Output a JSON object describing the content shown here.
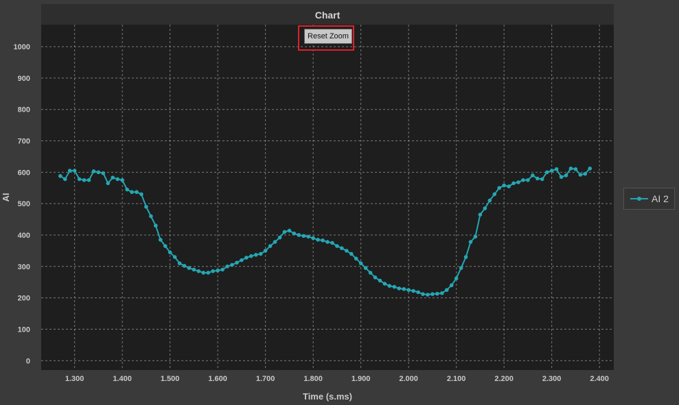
{
  "chart_data": {
    "type": "line",
    "title": "Chart",
    "xlabel": "Time (s.ms)",
    "ylabel": "AI",
    "xlim": [
      1.23,
      2.43
    ],
    "ylim": [
      -30,
      1070
    ],
    "x_ticks": [
      1.3,
      1.4,
      1.5,
      1.6,
      1.7,
      1.8,
      1.9,
      2.0,
      2.1,
      2.2,
      2.3,
      2.4
    ],
    "x_tick_labels": [
      "1.300",
      "1.400",
      "1.500",
      "1.600",
      "1.700",
      "1.800",
      "1.900",
      "2.000",
      "2.100",
      "2.200",
      "2.300",
      "2.400"
    ],
    "y_ticks": [
      0,
      100,
      200,
      300,
      400,
      500,
      600,
      700,
      800,
      900,
      1000
    ],
    "y_tick_labels": [
      "0",
      "100",
      "200",
      "300",
      "400",
      "500",
      "600",
      "700",
      "800",
      "900",
      "1000"
    ],
    "grid": true,
    "legend_position": "right",
    "series": [
      {
        "name": "AI 2",
        "color": "#25a7b3",
        "x": [
          1.27,
          1.28,
          1.29,
          1.3,
          1.31,
          1.32,
          1.33,
          1.34,
          1.35,
          1.36,
          1.37,
          1.38,
          1.39,
          1.4,
          1.41,
          1.42,
          1.43,
          1.44,
          1.45,
          1.46,
          1.47,
          1.48,
          1.49,
          1.5,
          1.51,
          1.52,
          1.53,
          1.54,
          1.55,
          1.56,
          1.57,
          1.58,
          1.59,
          1.6,
          1.61,
          1.62,
          1.63,
          1.64,
          1.65,
          1.66,
          1.67,
          1.68,
          1.69,
          1.7,
          1.71,
          1.72,
          1.73,
          1.74,
          1.75,
          1.76,
          1.77,
          1.78,
          1.79,
          1.8,
          1.81,
          1.82,
          1.83,
          1.84,
          1.85,
          1.86,
          1.87,
          1.88,
          1.89,
          1.9,
          1.91,
          1.92,
          1.93,
          1.94,
          1.95,
          1.96,
          1.97,
          1.98,
          1.99,
          2.0,
          2.01,
          2.02,
          2.03,
          2.04,
          2.05,
          2.06,
          2.07,
          2.08,
          2.09,
          2.1,
          2.11,
          2.12,
          2.13,
          2.14,
          2.15,
          2.16,
          2.17,
          2.18,
          2.19,
          2.2,
          2.21,
          2.22,
          2.23,
          2.24,
          2.25,
          2.26,
          2.27,
          2.28,
          2.29,
          2.3,
          2.31,
          2.32,
          2.33,
          2.34,
          2.35,
          2.36,
          2.37,
          2.38
        ],
        "y": [
          588,
          578,
          605,
          605,
          578,
          575,
          575,
          603,
          600,
          597,
          565,
          583,
          578,
          575,
          545,
          537,
          537,
          530,
          490,
          460,
          430,
          385,
          365,
          345,
          330,
          310,
          302,
          295,
          290,
          285,
          280,
          280,
          285,
          287,
          290,
          300,
          305,
          312,
          320,
          328,
          333,
          337,
          340,
          350,
          365,
          378,
          392,
          410,
          414,
          405,
          400,
          397,
          395,
          390,
          385,
          383,
          378,
          375,
          365,
          358,
          350,
          340,
          325,
          310,
          295,
          280,
          265,
          255,
          245,
          238,
          235,
          230,
          228,
          225,
          222,
          218,
          212,
          210,
          212,
          213,
          215,
          225,
          240,
          262,
          295,
          330,
          378,
          395,
          465,
          485,
          510,
          530,
          550,
          558,
          555,
          565,
          568,
          575,
          575,
          590,
          580,
          578,
          600,
          605,
          610,
          585,
          590,
          612,
          610,
          592,
          595,
          612
        ]
      }
    ]
  },
  "ui": {
    "reset_zoom_label": "Reset Zoom",
    "legend_label": "AI 2"
  }
}
